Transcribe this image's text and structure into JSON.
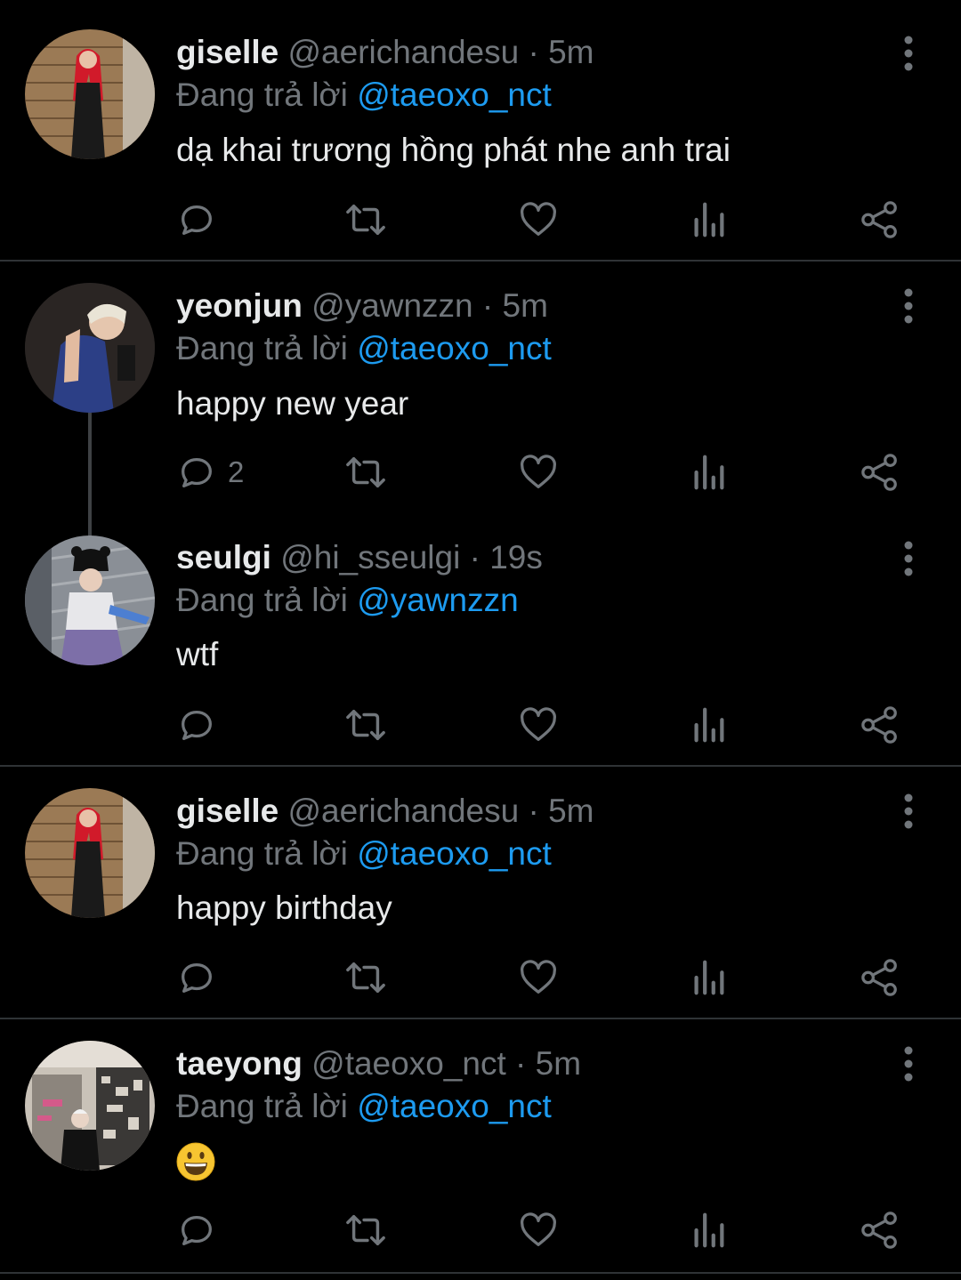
{
  "reply_prefix": "Đang trả lời",
  "tweets": [
    {
      "name": "giselle",
      "handle": "@aerichandesu",
      "separator": "·",
      "time": "5m",
      "reply_to": "@taeoxo_nct",
      "text": "dạ khai trương hồng phát nhe anh trai",
      "reply_count": ""
    },
    {
      "name": "yeonjun",
      "handle": "@yawnzzn",
      "separator": "·",
      "time": "5m",
      "reply_to": "@taeoxo_nct",
      "text": "happy new year",
      "reply_count": "2"
    },
    {
      "name": "seulgi",
      "handle": "@hi_sseulgi",
      "separator": "·",
      "time": "19s",
      "reply_to": "@yawnzzn",
      "text": "wtf",
      "reply_count": ""
    },
    {
      "name": "giselle",
      "handle": "@aerichandesu",
      "separator": "·",
      "time": "5m",
      "reply_to": "@taeoxo_nct",
      "text": "happy birthday",
      "reply_count": ""
    },
    {
      "name": "taeyong",
      "handle": "@taeoxo_nct",
      "separator": "·",
      "time": "5m",
      "reply_to": "@taeoxo_nct",
      "text": "",
      "emoji": "grinning-face",
      "reply_count": ""
    }
  ],
  "colors": {
    "background": "#000000",
    "text": "#e7e9ea",
    "muted": "#71767b",
    "link": "#1d9bf0",
    "divider": "#2f3336"
  }
}
